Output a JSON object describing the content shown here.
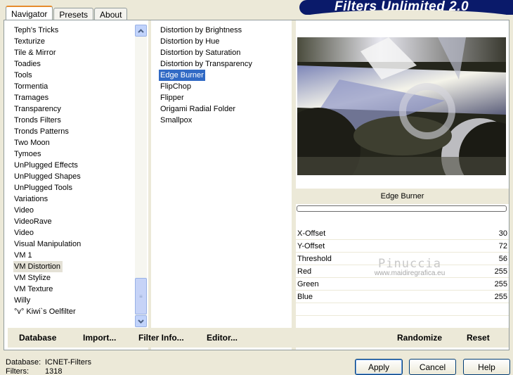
{
  "banner": {
    "title": "Filters Unlimited 2.0"
  },
  "tabs": [
    {
      "label": "Navigator",
      "active": true
    },
    {
      "label": "Presets",
      "active": false
    },
    {
      "label": "About",
      "active": false
    }
  ],
  "categories": [
    "Teph's Tricks",
    "Texturize",
    "Tile & Mirror",
    "Toadies",
    "Tools",
    "Tormentia",
    "Tramages",
    "Transparency",
    "Tronds Filters",
    "Tronds Patterns",
    "Two Moon",
    "Tymoes",
    "UnPlugged Effects",
    "UnPlugged Shapes",
    "UnPlugged Tools",
    "Variations",
    "Video",
    "VideoRave",
    "Video",
    "Visual Manipulation",
    "VM 1",
    "VM Distortion",
    "VM Stylize",
    "VM Texture",
    "Willy",
    "°v° Kiwi`s Oelfilter"
  ],
  "selected_category": "VM Distortion",
  "filters": [
    "Distortion by Brightness",
    "Distortion by Hue",
    "Distortion by Saturation",
    "Distortion by Transparency",
    "Edge Burner",
    "FlipChop",
    "Flipper",
    "Origami Radial Folder",
    "Smallpox"
  ],
  "selected_filter": "Edge Burner",
  "filter_name": "Edge Burner",
  "params": [
    {
      "label": "X-Offset",
      "value": "30"
    },
    {
      "label": "Y-Offset",
      "value": "72"
    },
    {
      "label": "Threshold",
      "value": "56"
    },
    {
      "label": "Red",
      "value": "255"
    },
    {
      "label": "Green",
      "value": "255"
    },
    {
      "label": "Blue",
      "value": "255"
    }
  ],
  "watermark": {
    "name": "Pinuccia",
    "site": "www.maidiregrafica.eu"
  },
  "left_buttons": {
    "database": "Database",
    "import": "Import...",
    "filter_info": "Filter Info...",
    "editor": "Editor..."
  },
  "right_buttons": {
    "randomize": "Randomize",
    "reset": "Reset"
  },
  "status": {
    "database_label": "Database:",
    "database_value": "ICNET-Filters",
    "filters_label": "Filters:",
    "filters_value": "1318"
  },
  "dialog": {
    "apply": "Apply",
    "cancel": "Cancel",
    "help": "Help"
  },
  "colors": {
    "selection": "#316ac5",
    "banner": "#0a1a6a",
    "face": "#ece9d8"
  }
}
